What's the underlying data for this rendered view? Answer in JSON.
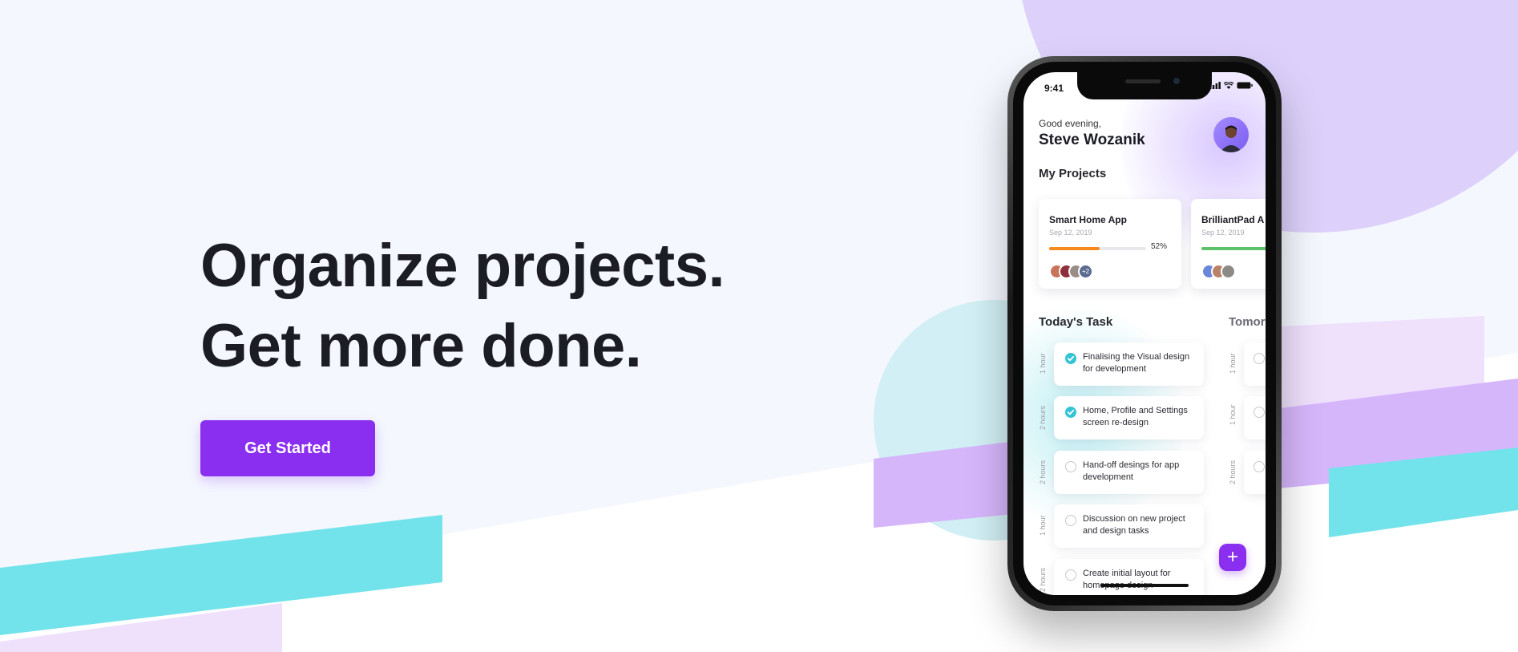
{
  "hero": {
    "headline_line1": "Organize projects.",
    "headline_line2": "Get more done.",
    "cta_label": "Get Started"
  },
  "colors": {
    "accent": "#8a2ef0",
    "teal": "#72e3ea",
    "lavender": "#d6b6fb",
    "pale_lavender": "#efe0fc",
    "circle_purple": "#ddd1fb",
    "page_bg": "#f4f8fe"
  },
  "phone": {
    "status_time": "9:41",
    "status_icons": [
      "signal-icon",
      "wifi-icon",
      "battery-icon"
    ],
    "greeting": "Good evening,",
    "user_name": "Steve Wozanik",
    "my_projects_title": "My Projects",
    "projects": [
      {
        "name": "Smart Home App",
        "date": "Sep 12, 2019",
        "progress": 0.52,
        "progress_label": "52%",
        "bar_color": "#f58a1f",
        "more_members": "+2"
      },
      {
        "name": "BrilliantPad A",
        "date": "Sep 12, 2019",
        "progress": 0.85,
        "bar_color": "#5cc36b"
      }
    ],
    "today_title": "Today's Task",
    "tomorrow_title": "Tomor",
    "today_tasks": [
      {
        "text": "Finalising the Visual design for development",
        "duration": "1 hour",
        "done": true
      },
      {
        "text": "Home, Profile and Settings screen re-design",
        "duration": "2 hours",
        "done": true
      },
      {
        "text": "Hand-off desings for app development",
        "duration": "2 hours",
        "done": false
      },
      {
        "text": "Discussion on new project and design tasks",
        "duration": "1 hour",
        "done": false
      },
      {
        "text": "Create initial layout for homepage design",
        "duration": "2 hours",
        "done": false
      }
    ],
    "tomorrow_tasks": [
      {
        "duration": "1 hour"
      },
      {
        "duration": "1 hour"
      },
      {
        "duration": "2 hours"
      }
    ],
    "fab_label": "+"
  }
}
